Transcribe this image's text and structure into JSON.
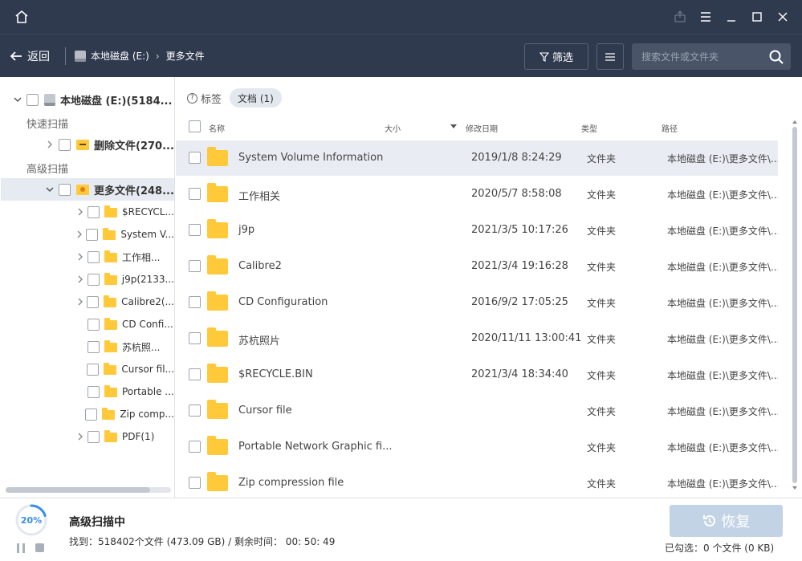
{
  "toolbar": {
    "back_label": "返回",
    "breadcrumb": [
      "本地磁盘 (E:)",
      "更多文件"
    ],
    "filter_label": "筛选",
    "search_placeholder": "搜索文件或文件夹"
  },
  "tree": {
    "root_label": "本地磁盘 (E:)(5184...",
    "quick_scan_label": "快速扫描",
    "deleted_files_label": "删除文件(270...",
    "advanced_scan_label": "高级扫描",
    "more_files_label": "更多文件(248...",
    "children": [
      {
        "label": "$RECYCL...",
        "expandable": true
      },
      {
        "label": "System V...",
        "expandable": true
      },
      {
        "label": "工作相...",
        "expandable": true
      },
      {
        "label": "j9p(2133...",
        "expandable": true
      },
      {
        "label": "Calibre2(...",
        "expandable": true
      },
      {
        "label": "CD Confi...",
        "expandable": false
      },
      {
        "label": "苏杭照...",
        "expandable": false
      },
      {
        "label": "Cursor fil...",
        "expandable": false
      },
      {
        "label": "Portable ...",
        "expandable": false
      },
      {
        "label": "Zip comp...",
        "expandable": false
      },
      {
        "label": "PDF(1)",
        "expandable": true
      }
    ]
  },
  "tags": {
    "label": "标签",
    "chip": "文档 (1)"
  },
  "list": {
    "headers": {
      "name": "名称",
      "size": "大小",
      "date": "修改日期",
      "type": "类型",
      "path": "路径"
    },
    "rows": [
      {
        "name": "System Volume Information",
        "date": "2019/1/8 8:24:29",
        "type": "文件夹",
        "path": "本地磁盘 (E:)\\更多文件\\..."
      },
      {
        "name": "工作相关",
        "date": "2020/5/7 8:58:08",
        "type": "文件夹",
        "path": "本地磁盘 (E:)\\更多文件\\..."
      },
      {
        "name": "j9p",
        "date": "2021/3/5 10:17:26",
        "type": "文件夹",
        "path": "本地磁盘 (E:)\\更多文件\\..."
      },
      {
        "name": "Calibre2",
        "date": "2021/3/4 19:16:28",
        "type": "文件夹",
        "path": "本地磁盘 (E:)\\更多文件\\..."
      },
      {
        "name": "CD Configuration",
        "date": "2016/9/2 17:05:25",
        "type": "文件夹",
        "path": "本地磁盘 (E:)\\更多文件\\..."
      },
      {
        "name": "苏杭照片",
        "date": "2020/11/11 13:00:41",
        "type": "文件夹",
        "path": "本地磁盘 (E:)\\更多文件\\..."
      },
      {
        "name": "$RECYCLE.BIN",
        "date": "2021/3/4 18:34:40",
        "type": "文件夹",
        "path": "本地磁盘 (E:)\\更多文件\\..."
      },
      {
        "name": "Cursor file",
        "date": "",
        "type": "文件夹",
        "path": "本地磁盘 (E:)\\更多文件\\..."
      },
      {
        "name": "Portable Network Graphic fi...",
        "date": "",
        "type": "文件夹",
        "path": "本地磁盘 (E:)\\更多文件\\..."
      },
      {
        "name": "Zip compression file",
        "date": "",
        "type": "文件夹",
        "path": "本地磁盘 (E:)\\更多文件\\..."
      }
    ]
  },
  "status": {
    "progress": "20%",
    "progress_value": 0.2,
    "title": "高级扫描中",
    "info": "找到：518402个文件 (473.09 GB) / 剩余时间： 00: 50: 49",
    "recover_label": "恢复",
    "selected_info": "已勾选：0 个文件 (0 KB)"
  },
  "colors": {
    "header_bg": "#303a4f",
    "folder": "#ffc93a",
    "accent": "#3a8ee6",
    "recover_disabled": "#c3d3e6"
  }
}
